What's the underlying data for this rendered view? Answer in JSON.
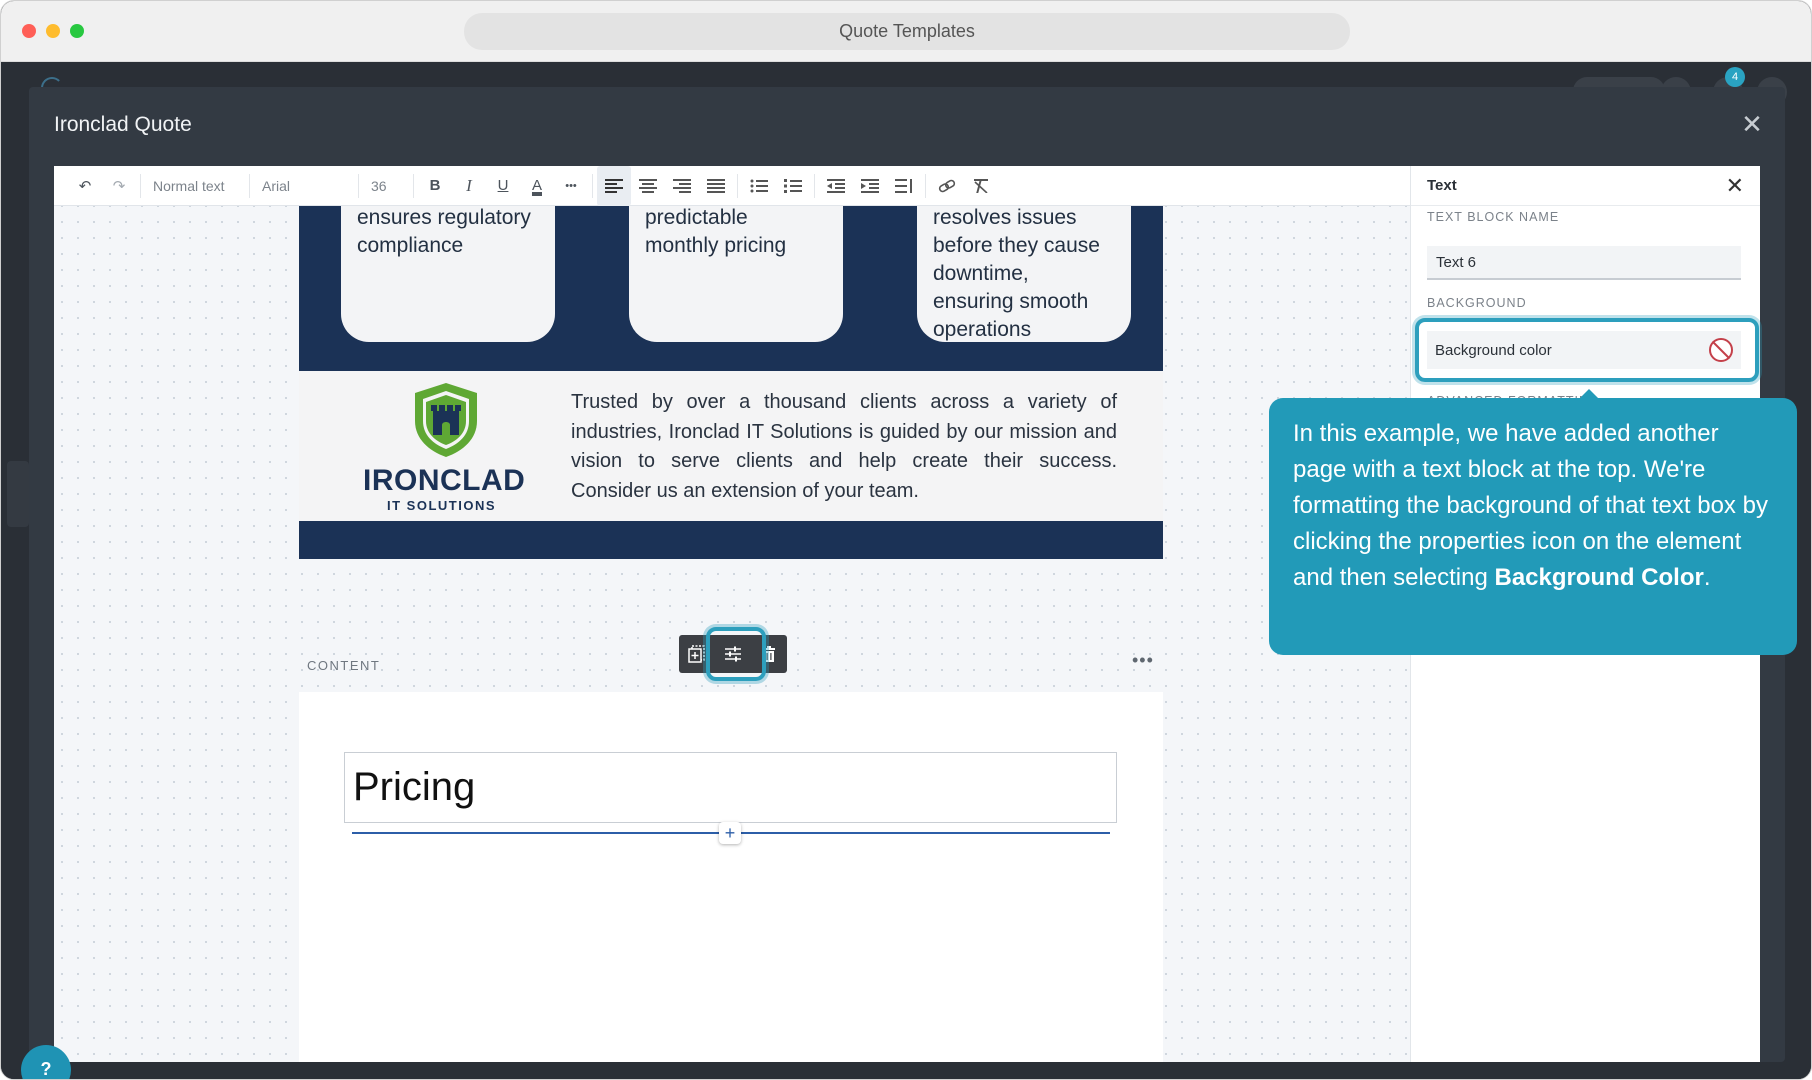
{
  "window": {
    "title": "Quote Templates"
  },
  "background_app": {
    "badge_count": "4"
  },
  "modal": {
    "title": "Ironclad Quote",
    "close": "✕"
  },
  "toolbar": {
    "undo": "↶",
    "redo": "↷",
    "paragraph_style": "Normal text",
    "font_family": "Arial",
    "font_size": "36",
    "bold": "B",
    "italic": "I",
    "underline": "U",
    "text_color": "A",
    "more": "•••"
  },
  "page1": {
    "cards": [
      {
        "text": "ensures regulatory compliance"
      },
      {
        "text": "predictable monthly pricing"
      },
      {
        "text": "resolves issues before they cause downtime, ensuring smooth operations"
      }
    ],
    "logo_word": "IRONCLAD",
    "logo_sub": "IT SOLUTIONS",
    "band_text": "Trusted by over a thousand clients across a variety of industries, Ironclad IT Solutions is guided by our mission and vision to serve clients and help create their success. Consider us an extension of your team.",
    "colors": {
      "navy": "#1b3256",
      "shield_green": "#5fa834"
    }
  },
  "content_section": {
    "label": "CONTENT",
    "add": "+",
    "more": "•••"
  },
  "page2": {
    "heading": "Pricing",
    "add_below": "+"
  },
  "panel": {
    "title": "Text",
    "close": "✕",
    "block_name_label": "TEXT BLOCK NAME",
    "block_name_value": "Text 6",
    "background_label": "BACKGROUND",
    "background_field": "Background color",
    "advanced_label": "ADVANCED FORMATTING"
  },
  "tooltip": {
    "text_before": "In this example, we have added another page with a text block at the top. We're formatting the background of that text box by clicking the properties icon on the element and then selecting ",
    "bold": "Background Color",
    "text_after": "."
  },
  "help": {
    "label": "?"
  },
  "accent_color": "#229ab8"
}
